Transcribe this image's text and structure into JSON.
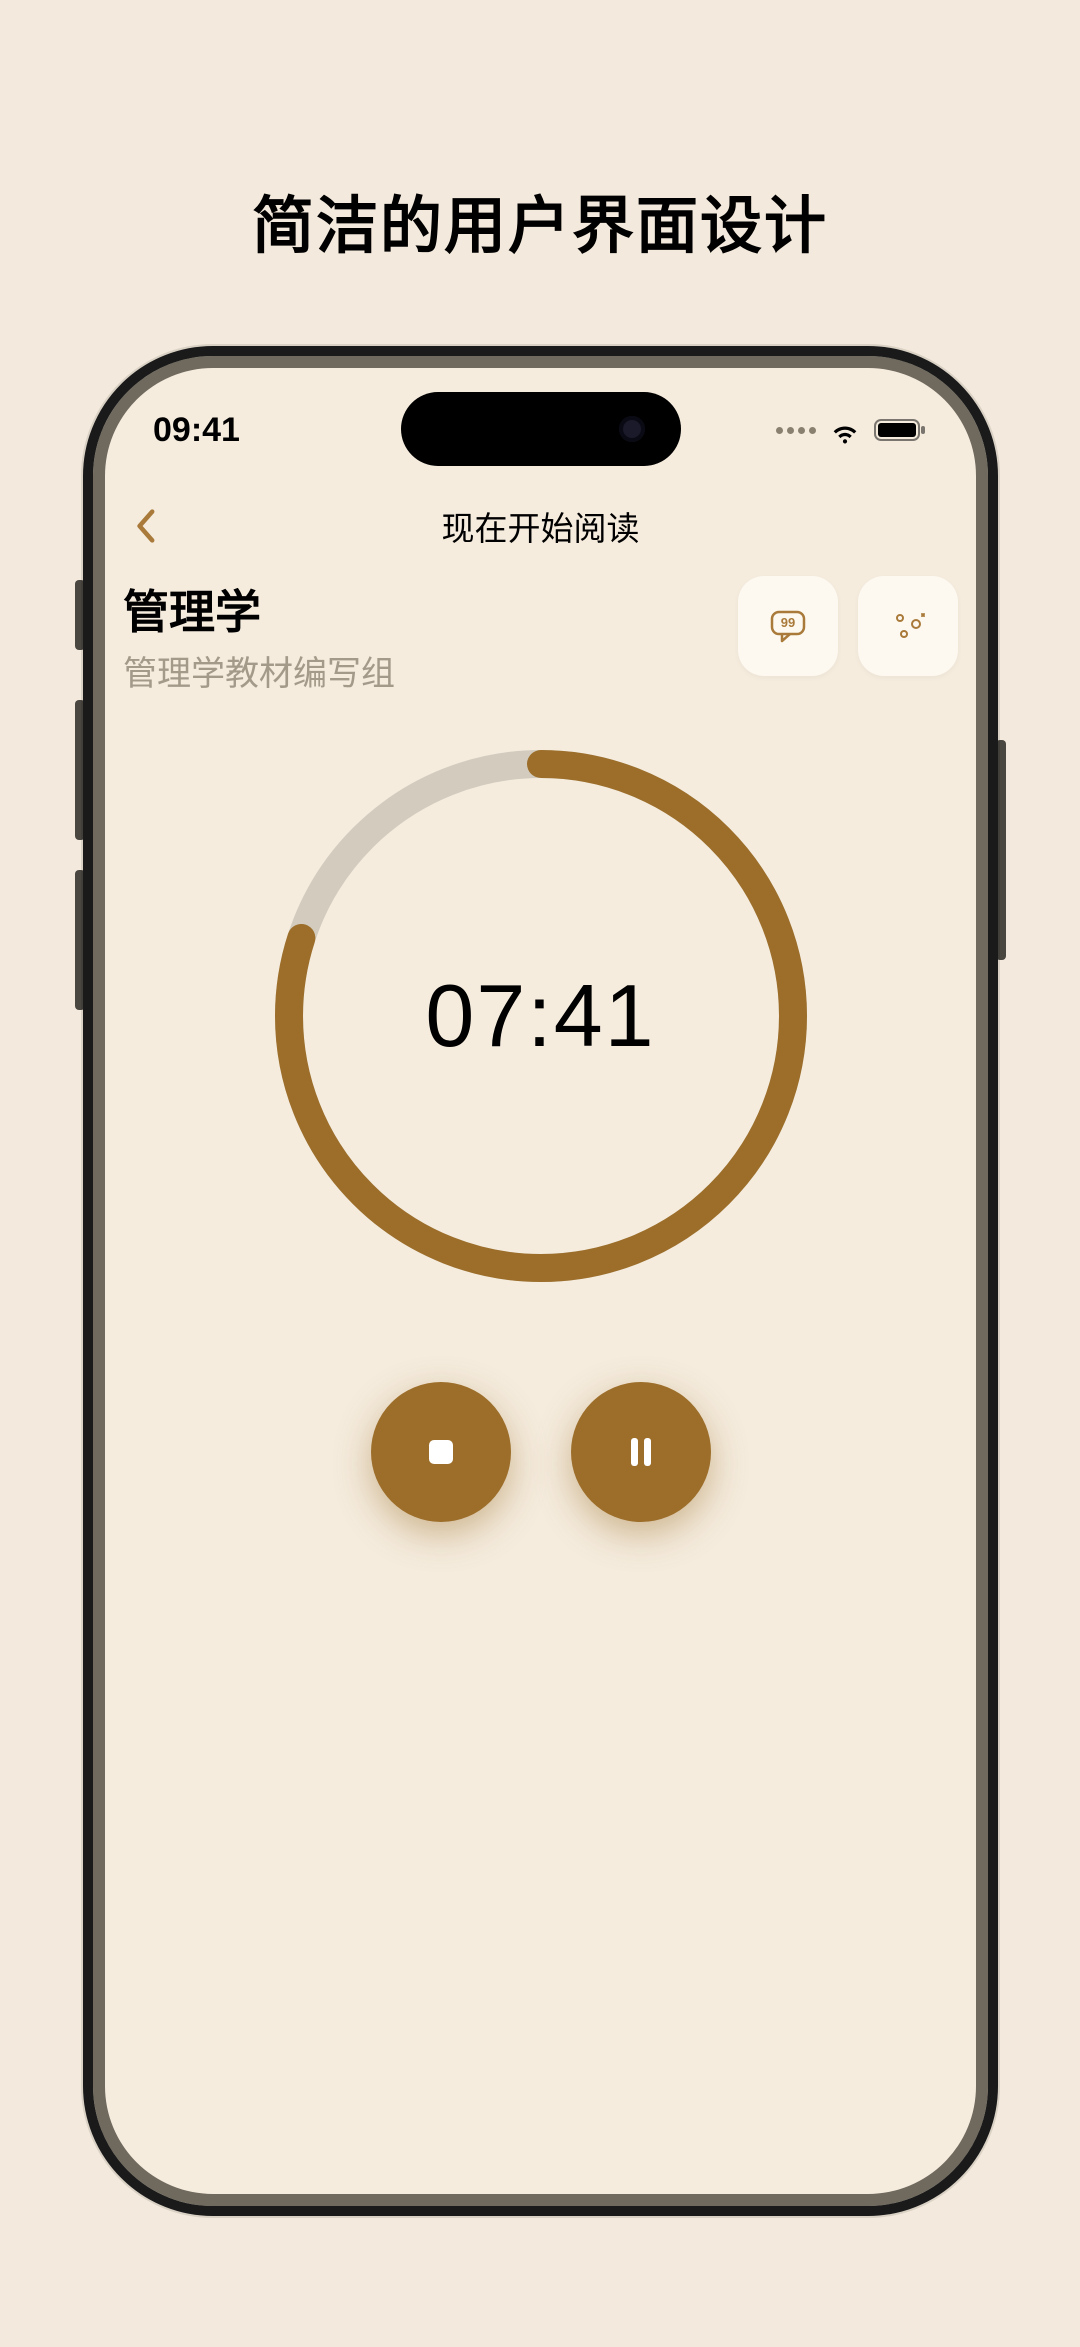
{
  "page": {
    "headline": "简洁的用户界面设计"
  },
  "statusbar": {
    "time": "09:41"
  },
  "nav": {
    "title": "现在开始阅读"
  },
  "book": {
    "title": "管理学",
    "subtitle": "管理学教材编写组"
  },
  "timer": {
    "display": "07:41",
    "progress_percent": 80
  },
  "icons": {
    "comment": "comment-bubble",
    "sparkle": "sparkle",
    "stop": "stop",
    "pause": "pause",
    "back": "chevron-left"
  },
  "colors": {
    "accent": "#9c6e2a",
    "screen_bg": "#f5ecde",
    "page_bg": "#f3e9dc",
    "ring_track": "#d3ccbe",
    "btn_bg": "#fdf9f1",
    "muted_text": "#a39a8a"
  }
}
